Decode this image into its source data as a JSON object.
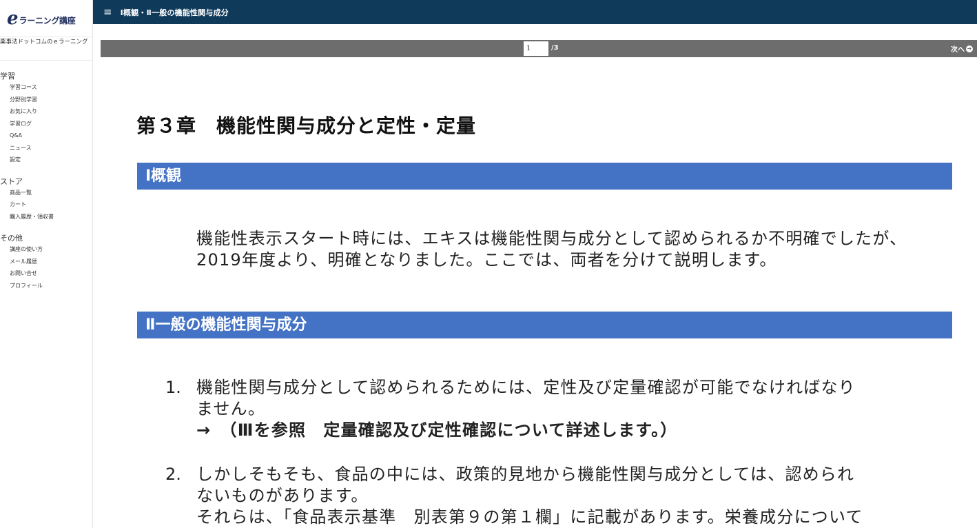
{
  "sidebar": {
    "logo_e": "e",
    "logo_text": "ラーニング講座",
    "site_name": "薬事法ドットコムのｅラーニング",
    "sections": [
      {
        "title": "学習",
        "items": [
          "学習コース",
          "分野別学習",
          "お気に入り",
          "学習ログ",
          "Q&A",
          "ニュース",
          "設定"
        ]
      },
      {
        "title": "ストア",
        "items": [
          "商品一覧",
          "カート",
          "購入履歴・領収書"
        ]
      },
      {
        "title": "その他",
        "items": [
          "講座の使い方",
          "メール履歴",
          "お問い合せ",
          "プロフィール"
        ]
      }
    ]
  },
  "header": {
    "menu_icon": "≡",
    "title": "Ⅰ概観・Ⅱ一般の機能性関与成分"
  },
  "pager": {
    "current_page": "1",
    "total": "/3",
    "next_label": "次へ",
    "next_icon": "➔"
  },
  "content": {
    "chapter_title": "第３章　機能性関与成分と定性・定量",
    "section1_title": "Ⅰ概観",
    "intro_line1": "機能性表示スタート時には、エキスは機能性関与成分として認められるか不明確でしたが、",
    "intro_line2": "2019年度より、明確となりました。ここでは、両者を分けて説明します。",
    "section2_title": "Ⅱ一般の機能性関与成分",
    "item1_num": "1.",
    "item1_line1": "機能性関与成分として認められるためには、定性及び定量確認が可能でなければなり",
    "item1_line2": "ません。",
    "item1_bold": "→　（Ⅲを参照　定量確認及び定性確認について詳述します。）",
    "item2_num": "2.",
    "item2_line1": "しかしそもそも、食品の中には、政策的見地から機能性関与成分としては、認められ",
    "item2_line2": "ないものがあります。",
    "item2_line3": "それらは、「食品表示基準　別表第９の第１欄」に記載があります。栄養成分について"
  },
  "colors": {
    "topbar": "#0f3a5a",
    "pager": "#6d6d6d",
    "section_bar": "#4472c4",
    "logo": "#23315e"
  }
}
